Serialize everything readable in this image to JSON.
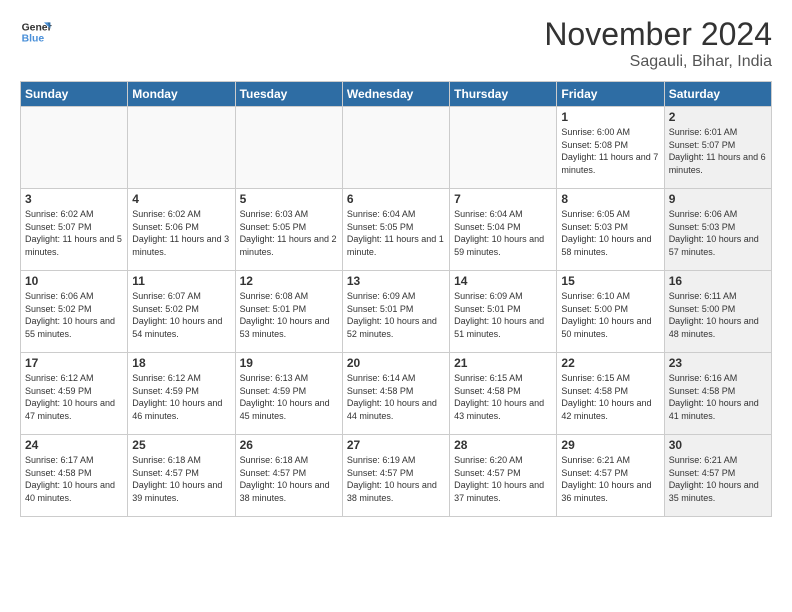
{
  "logo": {
    "line1": "General",
    "line2": "Blue"
  },
  "title": "November 2024",
  "subtitle": "Sagauli, Bihar, India",
  "header": {
    "days": [
      "Sunday",
      "Monday",
      "Tuesday",
      "Wednesday",
      "Thursday",
      "Friday",
      "Saturday"
    ]
  },
  "weeks": [
    {
      "cells": [
        {
          "day": null,
          "empty": true
        },
        {
          "day": null,
          "empty": true
        },
        {
          "day": null,
          "empty": true
        },
        {
          "day": null,
          "empty": true
        },
        {
          "day": null,
          "empty": true
        },
        {
          "day": "1",
          "info": "Sunrise: 6:00 AM\nSunset: 5:08 PM\nDaylight: 11 hours\nand 7 minutes."
        },
        {
          "day": "2",
          "info": "Sunrise: 6:01 AM\nSunset: 5:07 PM\nDaylight: 11 hours\nand 6 minutes."
        }
      ]
    },
    {
      "cells": [
        {
          "day": "3",
          "info": "Sunrise: 6:02 AM\nSunset: 5:07 PM\nDaylight: 11 hours\nand 5 minutes."
        },
        {
          "day": "4",
          "info": "Sunrise: 6:02 AM\nSunset: 5:06 PM\nDaylight: 11 hours\nand 3 minutes."
        },
        {
          "day": "5",
          "info": "Sunrise: 6:03 AM\nSunset: 5:05 PM\nDaylight: 11 hours\nand 2 minutes."
        },
        {
          "day": "6",
          "info": "Sunrise: 6:04 AM\nSunset: 5:05 PM\nDaylight: 11 hours\nand 1 minute."
        },
        {
          "day": "7",
          "info": "Sunrise: 6:04 AM\nSunset: 5:04 PM\nDaylight: 10 hours\nand 59 minutes."
        },
        {
          "day": "8",
          "info": "Sunrise: 6:05 AM\nSunset: 5:03 PM\nDaylight: 10 hours\nand 58 minutes."
        },
        {
          "day": "9",
          "info": "Sunrise: 6:06 AM\nSunset: 5:03 PM\nDaylight: 10 hours\nand 57 minutes."
        }
      ]
    },
    {
      "cells": [
        {
          "day": "10",
          "info": "Sunrise: 6:06 AM\nSunset: 5:02 PM\nDaylight: 10 hours\nand 55 minutes."
        },
        {
          "day": "11",
          "info": "Sunrise: 6:07 AM\nSunset: 5:02 PM\nDaylight: 10 hours\nand 54 minutes."
        },
        {
          "day": "12",
          "info": "Sunrise: 6:08 AM\nSunset: 5:01 PM\nDaylight: 10 hours\nand 53 minutes."
        },
        {
          "day": "13",
          "info": "Sunrise: 6:09 AM\nSunset: 5:01 PM\nDaylight: 10 hours\nand 52 minutes."
        },
        {
          "day": "14",
          "info": "Sunrise: 6:09 AM\nSunset: 5:01 PM\nDaylight: 10 hours\nand 51 minutes."
        },
        {
          "day": "15",
          "info": "Sunrise: 6:10 AM\nSunset: 5:00 PM\nDaylight: 10 hours\nand 50 minutes."
        },
        {
          "day": "16",
          "info": "Sunrise: 6:11 AM\nSunset: 5:00 PM\nDaylight: 10 hours\nand 48 minutes."
        }
      ]
    },
    {
      "cells": [
        {
          "day": "17",
          "info": "Sunrise: 6:12 AM\nSunset: 4:59 PM\nDaylight: 10 hours\nand 47 minutes."
        },
        {
          "day": "18",
          "info": "Sunrise: 6:12 AM\nSunset: 4:59 PM\nDaylight: 10 hours\nand 46 minutes."
        },
        {
          "day": "19",
          "info": "Sunrise: 6:13 AM\nSunset: 4:59 PM\nDaylight: 10 hours\nand 45 minutes."
        },
        {
          "day": "20",
          "info": "Sunrise: 6:14 AM\nSunset: 4:58 PM\nDaylight: 10 hours\nand 44 minutes."
        },
        {
          "day": "21",
          "info": "Sunrise: 6:15 AM\nSunset: 4:58 PM\nDaylight: 10 hours\nand 43 minutes."
        },
        {
          "day": "22",
          "info": "Sunrise: 6:15 AM\nSunset: 4:58 PM\nDaylight: 10 hours\nand 42 minutes."
        },
        {
          "day": "23",
          "info": "Sunrise: 6:16 AM\nSunset: 4:58 PM\nDaylight: 10 hours\nand 41 minutes."
        }
      ]
    },
    {
      "cells": [
        {
          "day": "24",
          "info": "Sunrise: 6:17 AM\nSunset: 4:58 PM\nDaylight: 10 hours\nand 40 minutes."
        },
        {
          "day": "25",
          "info": "Sunrise: 6:18 AM\nSunset: 4:57 PM\nDaylight: 10 hours\nand 39 minutes."
        },
        {
          "day": "26",
          "info": "Sunrise: 6:18 AM\nSunset: 4:57 PM\nDaylight: 10 hours\nand 38 minutes."
        },
        {
          "day": "27",
          "info": "Sunrise: 6:19 AM\nSunset: 4:57 PM\nDaylight: 10 hours\nand 38 minutes."
        },
        {
          "day": "28",
          "info": "Sunrise: 6:20 AM\nSunset: 4:57 PM\nDaylight: 10 hours\nand 37 minutes."
        },
        {
          "day": "29",
          "info": "Sunrise: 6:21 AM\nSunset: 4:57 PM\nDaylight: 10 hours\nand 36 minutes."
        },
        {
          "day": "30",
          "info": "Sunrise: 6:21 AM\nSunset: 4:57 PM\nDaylight: 10 hours\nand 35 minutes."
        }
      ]
    }
  ]
}
